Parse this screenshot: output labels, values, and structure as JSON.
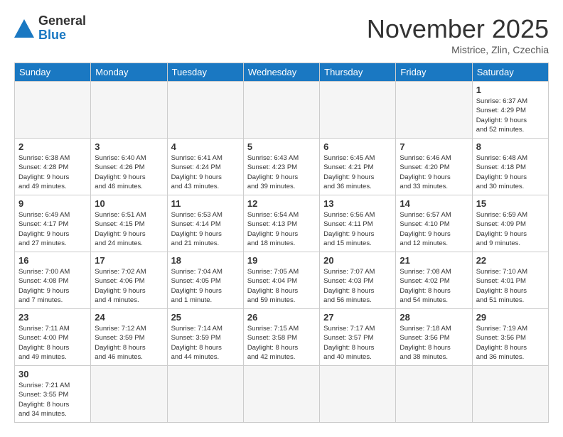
{
  "header": {
    "logo_general": "General",
    "logo_blue": "Blue",
    "month_title": "November 2025",
    "location": "Mistrice, Zlin, Czechia"
  },
  "weekdays": [
    "Sunday",
    "Monday",
    "Tuesday",
    "Wednesday",
    "Thursday",
    "Friday",
    "Saturday"
  ],
  "weeks": [
    [
      {
        "day": "",
        "info": ""
      },
      {
        "day": "",
        "info": ""
      },
      {
        "day": "",
        "info": ""
      },
      {
        "day": "",
        "info": ""
      },
      {
        "day": "",
        "info": ""
      },
      {
        "day": "",
        "info": ""
      },
      {
        "day": "1",
        "info": "Sunrise: 6:37 AM\nSunset: 4:29 PM\nDaylight: 9 hours\nand 52 minutes."
      }
    ],
    [
      {
        "day": "2",
        "info": "Sunrise: 6:38 AM\nSunset: 4:28 PM\nDaylight: 9 hours\nand 49 minutes."
      },
      {
        "day": "3",
        "info": "Sunrise: 6:40 AM\nSunset: 4:26 PM\nDaylight: 9 hours\nand 46 minutes."
      },
      {
        "day": "4",
        "info": "Sunrise: 6:41 AM\nSunset: 4:24 PM\nDaylight: 9 hours\nand 43 minutes."
      },
      {
        "day": "5",
        "info": "Sunrise: 6:43 AM\nSunset: 4:23 PM\nDaylight: 9 hours\nand 39 minutes."
      },
      {
        "day": "6",
        "info": "Sunrise: 6:45 AM\nSunset: 4:21 PM\nDaylight: 9 hours\nand 36 minutes."
      },
      {
        "day": "7",
        "info": "Sunrise: 6:46 AM\nSunset: 4:20 PM\nDaylight: 9 hours\nand 33 minutes."
      },
      {
        "day": "8",
        "info": "Sunrise: 6:48 AM\nSunset: 4:18 PM\nDaylight: 9 hours\nand 30 minutes."
      }
    ],
    [
      {
        "day": "9",
        "info": "Sunrise: 6:49 AM\nSunset: 4:17 PM\nDaylight: 9 hours\nand 27 minutes."
      },
      {
        "day": "10",
        "info": "Sunrise: 6:51 AM\nSunset: 4:15 PM\nDaylight: 9 hours\nand 24 minutes."
      },
      {
        "day": "11",
        "info": "Sunrise: 6:53 AM\nSunset: 4:14 PM\nDaylight: 9 hours\nand 21 minutes."
      },
      {
        "day": "12",
        "info": "Sunrise: 6:54 AM\nSunset: 4:13 PM\nDaylight: 9 hours\nand 18 minutes."
      },
      {
        "day": "13",
        "info": "Sunrise: 6:56 AM\nSunset: 4:11 PM\nDaylight: 9 hours\nand 15 minutes."
      },
      {
        "day": "14",
        "info": "Sunrise: 6:57 AM\nSunset: 4:10 PM\nDaylight: 9 hours\nand 12 minutes."
      },
      {
        "day": "15",
        "info": "Sunrise: 6:59 AM\nSunset: 4:09 PM\nDaylight: 9 hours\nand 9 minutes."
      }
    ],
    [
      {
        "day": "16",
        "info": "Sunrise: 7:00 AM\nSunset: 4:08 PM\nDaylight: 9 hours\nand 7 minutes."
      },
      {
        "day": "17",
        "info": "Sunrise: 7:02 AM\nSunset: 4:06 PM\nDaylight: 9 hours\nand 4 minutes."
      },
      {
        "day": "18",
        "info": "Sunrise: 7:04 AM\nSunset: 4:05 PM\nDaylight: 9 hours\nand 1 minute."
      },
      {
        "day": "19",
        "info": "Sunrise: 7:05 AM\nSunset: 4:04 PM\nDaylight: 8 hours\nand 59 minutes."
      },
      {
        "day": "20",
        "info": "Sunrise: 7:07 AM\nSunset: 4:03 PM\nDaylight: 8 hours\nand 56 minutes."
      },
      {
        "day": "21",
        "info": "Sunrise: 7:08 AM\nSunset: 4:02 PM\nDaylight: 8 hours\nand 54 minutes."
      },
      {
        "day": "22",
        "info": "Sunrise: 7:10 AM\nSunset: 4:01 PM\nDaylight: 8 hours\nand 51 minutes."
      }
    ],
    [
      {
        "day": "23",
        "info": "Sunrise: 7:11 AM\nSunset: 4:00 PM\nDaylight: 8 hours\nand 49 minutes."
      },
      {
        "day": "24",
        "info": "Sunrise: 7:12 AM\nSunset: 3:59 PM\nDaylight: 8 hours\nand 46 minutes."
      },
      {
        "day": "25",
        "info": "Sunrise: 7:14 AM\nSunset: 3:59 PM\nDaylight: 8 hours\nand 44 minutes."
      },
      {
        "day": "26",
        "info": "Sunrise: 7:15 AM\nSunset: 3:58 PM\nDaylight: 8 hours\nand 42 minutes."
      },
      {
        "day": "27",
        "info": "Sunrise: 7:17 AM\nSunset: 3:57 PM\nDaylight: 8 hours\nand 40 minutes."
      },
      {
        "day": "28",
        "info": "Sunrise: 7:18 AM\nSunset: 3:56 PM\nDaylight: 8 hours\nand 38 minutes."
      },
      {
        "day": "29",
        "info": "Sunrise: 7:19 AM\nSunset: 3:56 PM\nDaylight: 8 hours\nand 36 minutes."
      }
    ],
    [
      {
        "day": "30",
        "info": "Sunrise: 7:21 AM\nSunset: 3:55 PM\nDaylight: 8 hours\nand 34 minutes."
      },
      {
        "day": "",
        "info": ""
      },
      {
        "day": "",
        "info": ""
      },
      {
        "day": "",
        "info": ""
      },
      {
        "day": "",
        "info": ""
      },
      {
        "day": "",
        "info": ""
      },
      {
        "day": "",
        "info": ""
      }
    ]
  ]
}
